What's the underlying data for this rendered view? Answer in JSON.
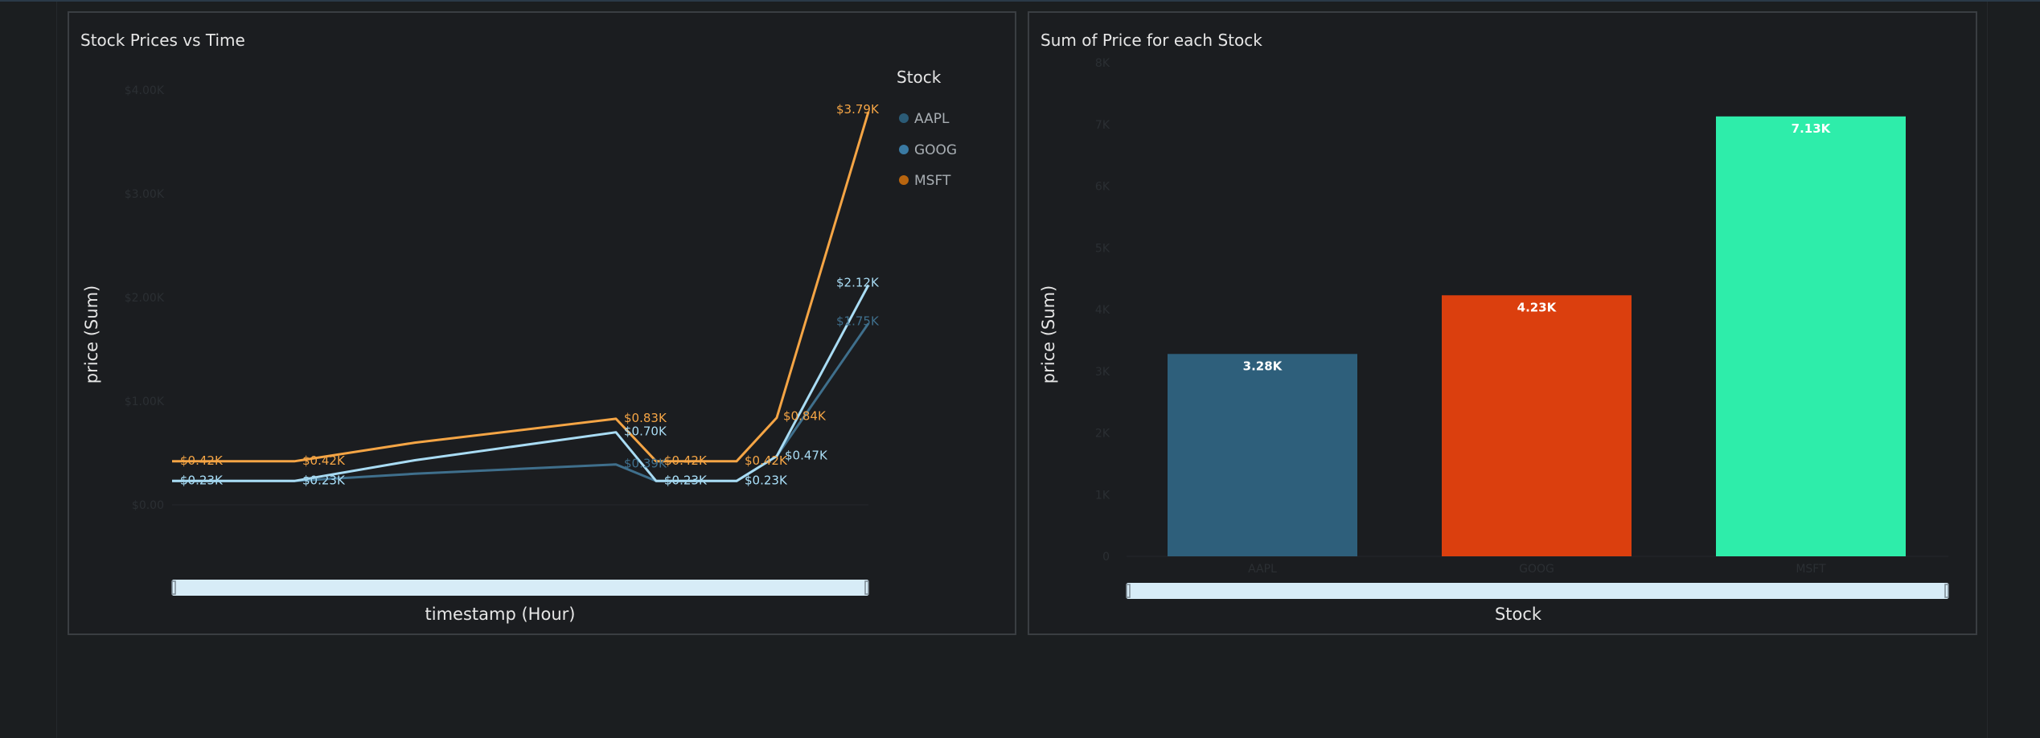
{
  "colors": {
    "background": "#1b1e20",
    "panel_border": "#3a3e42",
    "aapl": "#3f6f8c",
    "goog": "#a9dcf4",
    "msft": "#f5a545",
    "bar_aapl": "#2e5f7b",
    "bar_goog": "#db3f0e",
    "bar_msft": "#2eedaa",
    "scrollbar": "#d7ecf7"
  },
  "chart_data": [
    {
      "type": "line",
      "title": "Stock Prices vs Time",
      "xlabel": "timestamp (Hour)",
      "ylabel": "price (Sum)",
      "ylim": [
        0,
        4000
      ],
      "yticks": [
        "$0.00",
        "$1.00K",
        "$2.00K",
        "$3.00K",
        "$4.00K"
      ],
      "xticks": [
        "",
        "",
        ""
      ],
      "legend": {
        "title": "Stock",
        "placement": "right",
        "items": [
          "AAPL",
          "GOOG",
          "MSFT"
        ]
      },
      "x": [
        0,
        1,
        2,
        3,
        4,
        5,
        6,
        7
      ],
      "series": [
        {
          "name": "AAPL",
          "values": [
            230,
            230,
            300,
            390,
            230,
            230,
            470,
            1750
          ],
          "labels": [
            "$0.23K",
            "$0.23K",
            "",
            "$0.39K",
            "$0.23K",
            "$0.23K",
            "",
            "$1.75K"
          ]
        },
        {
          "name": "GOOG",
          "values": [
            230,
            230,
            430,
            700,
            230,
            230,
            470,
            2120
          ],
          "labels": [
            "$0.23K",
            "$0.23K",
            "",
            "$0.70K",
            "$0.23K",
            "$0.23K",
            "$0.47K",
            "$2.12K"
          ]
        },
        {
          "name": "MSFT",
          "values": [
            420,
            420,
            600,
            830,
            420,
            420,
            840,
            3790
          ],
          "labels": [
            "$0.42K",
            "$0.42K",
            "",
            "$0.83K",
            "$0.42K",
            "$0.42K",
            "$0.84K",
            "$3.79K"
          ]
        }
      ]
    },
    {
      "type": "bar",
      "title": "Sum of Price for each Stock",
      "xlabel": "Stock",
      "ylabel": "price (Sum)",
      "categories": [
        "AAPL",
        "GOOG",
        "MSFT"
      ],
      "values": [
        3280,
        4230,
        7130
      ],
      "value_labels": [
        "3.28K",
        "4.23K",
        "7.13K"
      ],
      "ylim": [
        0,
        8000
      ],
      "yticks": [
        "0",
        "1K",
        "2K",
        "3K",
        "4K",
        "5K",
        "6K",
        "7K",
        "8K"
      ]
    }
  ]
}
